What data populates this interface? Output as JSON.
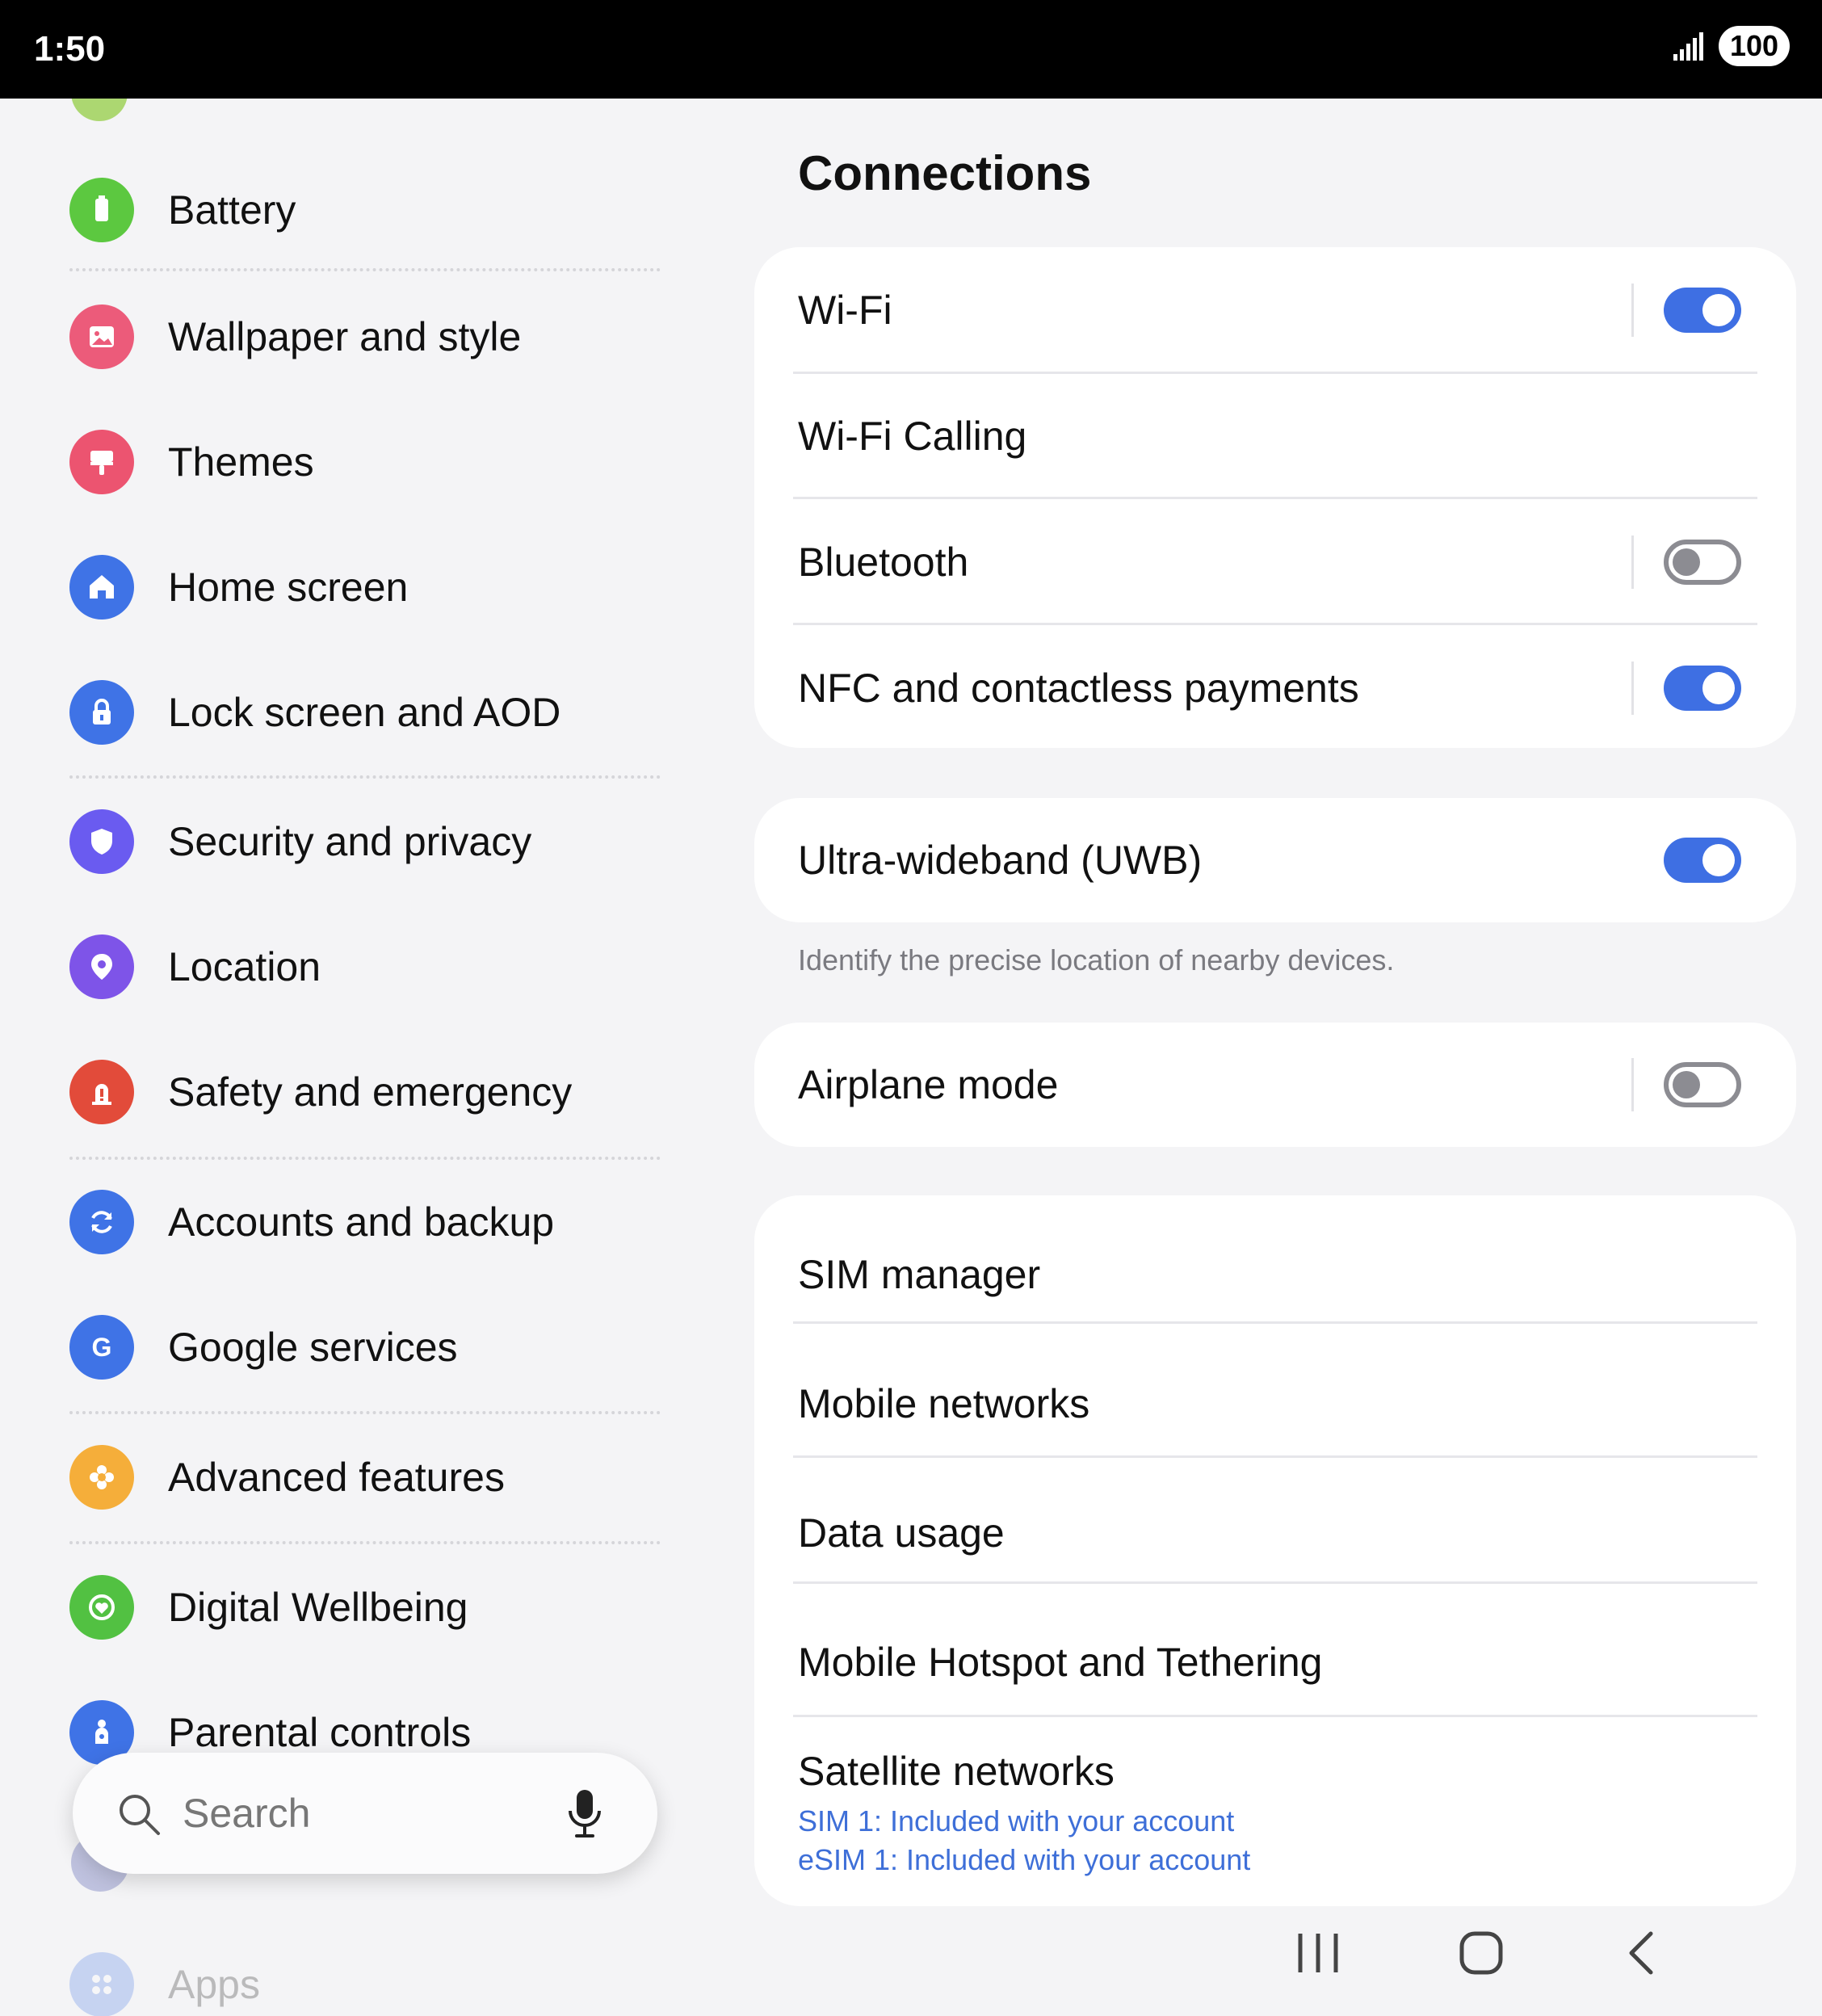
{
  "status_bar": {
    "time": "1:50",
    "battery": "100"
  },
  "sidebar": {
    "items": [
      {
        "label": "Battery",
        "icon": "battery-icon",
        "color": "#5cc840"
      },
      {
        "label": "Wallpaper and style",
        "icon": "image-icon",
        "color": "#ec5b7a"
      },
      {
        "label": "Themes",
        "icon": "paint-brush-icon",
        "color": "#ec5470"
      },
      {
        "label": "Home screen",
        "icon": "home-icon",
        "color": "#3f73e6"
      },
      {
        "label": "Lock screen and AOD",
        "icon": "lock-icon",
        "color": "#3f73e6"
      },
      {
        "label": "Security and privacy",
        "icon": "shield-icon",
        "color": "#6a5bf0"
      },
      {
        "label": "Location",
        "icon": "location-pin-icon",
        "color": "#7e54e8"
      },
      {
        "label": "Safety and emergency",
        "icon": "alert-icon",
        "color": "#e24b3a"
      },
      {
        "label": "Accounts and backup",
        "icon": "sync-icon",
        "color": "#3f73e6"
      },
      {
        "label": "Google services",
        "icon": "google-g-icon",
        "color": "#3f73e6"
      },
      {
        "label": "Advanced features",
        "icon": "puzzle-icon",
        "color": "#f5ae3a"
      },
      {
        "label": "Digital Wellbeing",
        "icon": "heart-ring-icon",
        "color": "#52c142"
      },
      {
        "label": "Parental controls",
        "icon": "parent-child-icon",
        "color": "#3f73e6"
      },
      {
        "label": "Apps",
        "icon": "apps-grid-icon",
        "color": "#3f73e6"
      }
    ]
  },
  "search": {
    "placeholder": "Search"
  },
  "connections": {
    "title": "Connections",
    "group1": [
      {
        "label": "Wi-Fi",
        "toggle": "on"
      },
      {
        "label": "Wi-Fi Calling"
      },
      {
        "label": "Bluetooth",
        "toggle": "off"
      },
      {
        "label": "NFC and contactless payments",
        "toggle": "on"
      }
    ],
    "uwb": {
      "label": "Ultra-wideband (UWB)",
      "toggle": "on",
      "helper": "Identify the precise location of nearby devices."
    },
    "airplane": {
      "label": "Airplane mode",
      "toggle": "off"
    },
    "group3": [
      {
        "label": "SIM manager"
      },
      {
        "label": "Mobile networks"
      },
      {
        "label": "Data usage"
      },
      {
        "label": "Mobile Hotspot and Tethering"
      },
      {
        "label": "Satellite networks",
        "sub1": "SIM 1: Included with your account",
        "sub2": "eSIM 1: Included with your account"
      }
    ]
  },
  "colors": {
    "accent": "#3e6fe3",
    "toggle_off": "#8c8c92"
  }
}
